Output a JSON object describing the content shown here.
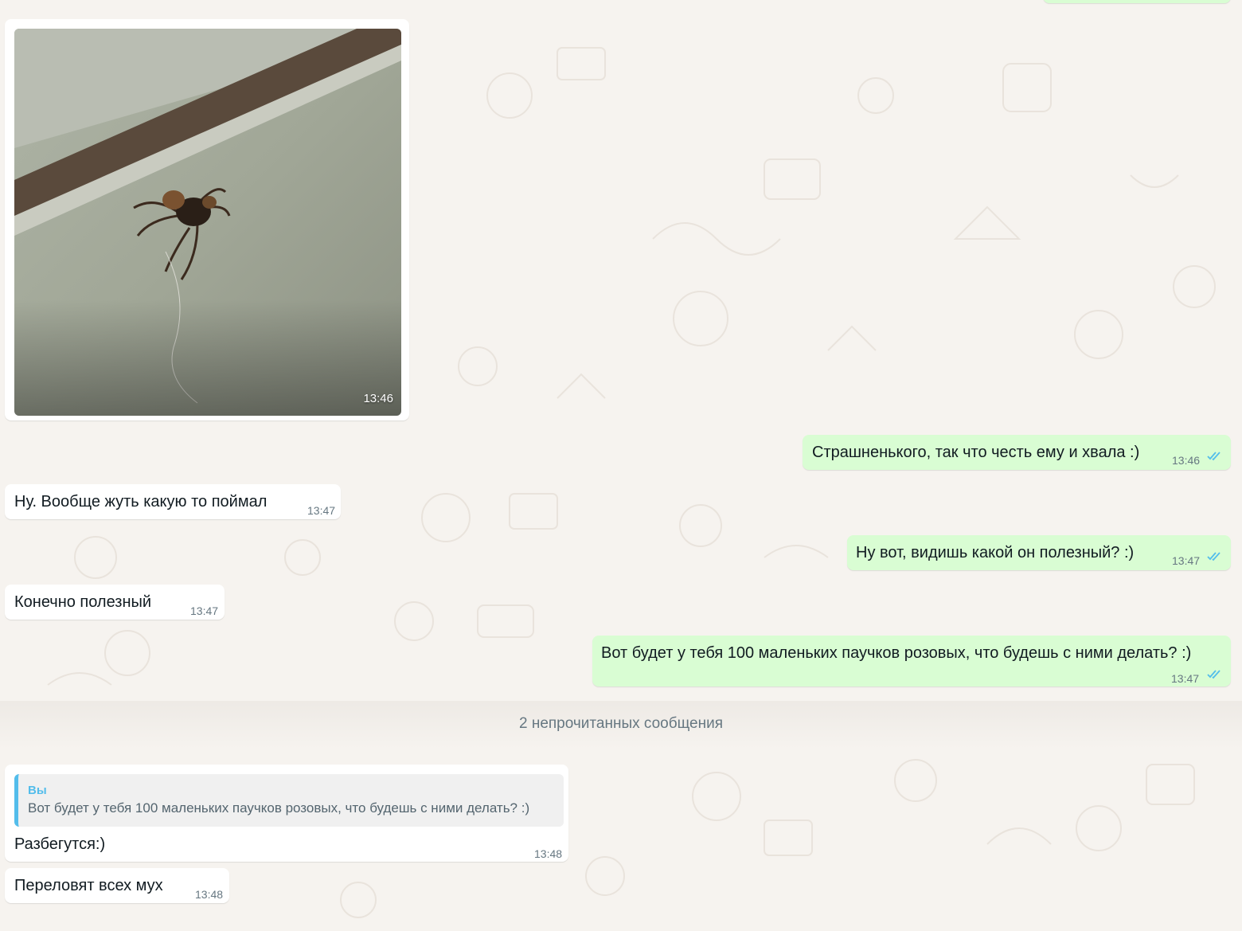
{
  "chat": {
    "photo_message": {
      "time": "13:46"
    },
    "messages": [
      {
        "text": "Страшненького, так что честь ему и хвала :)",
        "time": "13:46"
      },
      {
        "text": "Ну. Вообще жуть какую то поймал",
        "time": "13:47"
      },
      {
        "text": "Ну вот, видишь какой он полезный? :)",
        "time": "13:47"
      },
      {
        "text": "Конечно полезный",
        "time": "13:47"
      },
      {
        "text": "Вот будет у тебя 100 маленьких паучков розовых, что будешь с ними делать? :)",
        "time": "13:47"
      },
      {
        "text": "Разбегутся:)",
        "time": "13:48",
        "quote": {
          "author": "Вы",
          "text": "Вот будет у тебя 100 маленьких паучков розовых, что будешь с ними делать? :)"
        }
      },
      {
        "text": "Переловят всех мух",
        "time": "13:48"
      }
    ],
    "unread_divider": "2 непрочитанных сообщения"
  },
  "colors": {
    "background": "#f6f3ef",
    "outgoing_bubble": "#d9fdd3",
    "incoming_bubble": "#ffffff",
    "read_ticks": "#53bdeb",
    "timestamp": "#667781"
  },
  "icons": [
    "read-double-check-icon"
  ]
}
